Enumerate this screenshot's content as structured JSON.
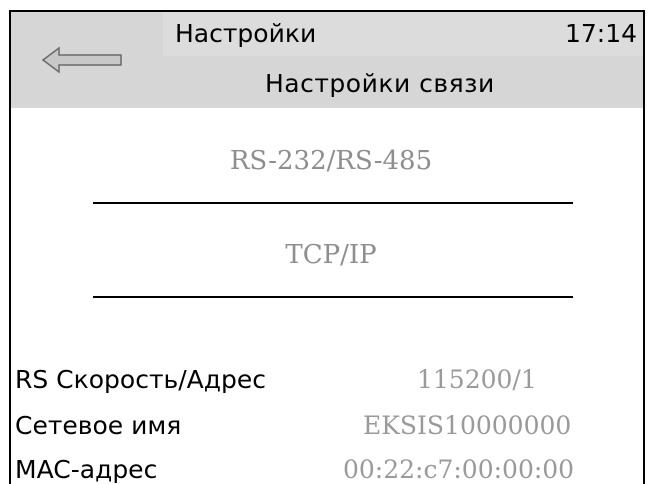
{
  "header": {
    "title": "Настройки",
    "time": "17:14",
    "subtitle": "Настройки связи"
  },
  "menu": [
    {
      "label": "RS-232/RS-485"
    },
    {
      "label": "TCP/IP"
    }
  ],
  "info": [
    {
      "label": "RS Скорость/Адрес",
      "value": "115200/1"
    },
    {
      "label": "Сетевое имя",
      "value": "EKSIS10000000"
    },
    {
      "label": "MAC-адрес",
      "value": "00:22:c7:00:00:00"
    }
  ]
}
